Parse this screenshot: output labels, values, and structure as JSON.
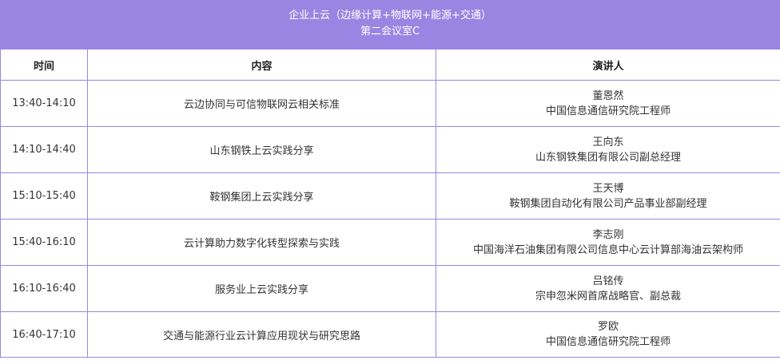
{
  "banner": {
    "title": "企业上云（边缘计算+物联网+能源+交通）",
    "room": "第二会议室C"
  },
  "table": {
    "headers": {
      "time": "时间",
      "content": "内容",
      "speaker": "演讲人"
    },
    "rows": [
      {
        "time": "13:40-14:10",
        "content": "云边协同与可信物联网云相关标准",
        "speaker_name": "董恩然",
        "speaker_title": "中国信息通信研究院工程师"
      },
      {
        "time": "14:10-14:40",
        "content": "山东钢铁上云实践分享",
        "speaker_name": "王向东",
        "speaker_title": "山东钢铁集团有限公司副总经理"
      },
      {
        "time": "15:10-15:40",
        "content": "鞍钢集团上云实践分享",
        "speaker_name": "王天博",
        "speaker_title": "鞍钢集团自动化有限公司产品事业部副经理"
      },
      {
        "time": "15:40-16:10",
        "content": "云计算助力数字化转型探索与实践",
        "speaker_name": "李志刚",
        "speaker_title": "中国海洋石油集团有限公司信息中心云计算部海油云架构师"
      },
      {
        "time": "16:10-16:40",
        "content": "服务业上云实践分享",
        "speaker_name": "吕铭传",
        "speaker_title": "宗申忽米网首席战略官、副总裁"
      },
      {
        "time": "16:40-17:10",
        "content": "交通与能源行业云计算应用现状与研究思路",
        "speaker_name": "罗欧",
        "speaker_title": "中国信息通信研究院工程师"
      }
    ]
  },
  "colors": {
    "banner_bg": "#9b85e2",
    "border": "#9b85e2",
    "banner_text": "#ffffff"
  }
}
